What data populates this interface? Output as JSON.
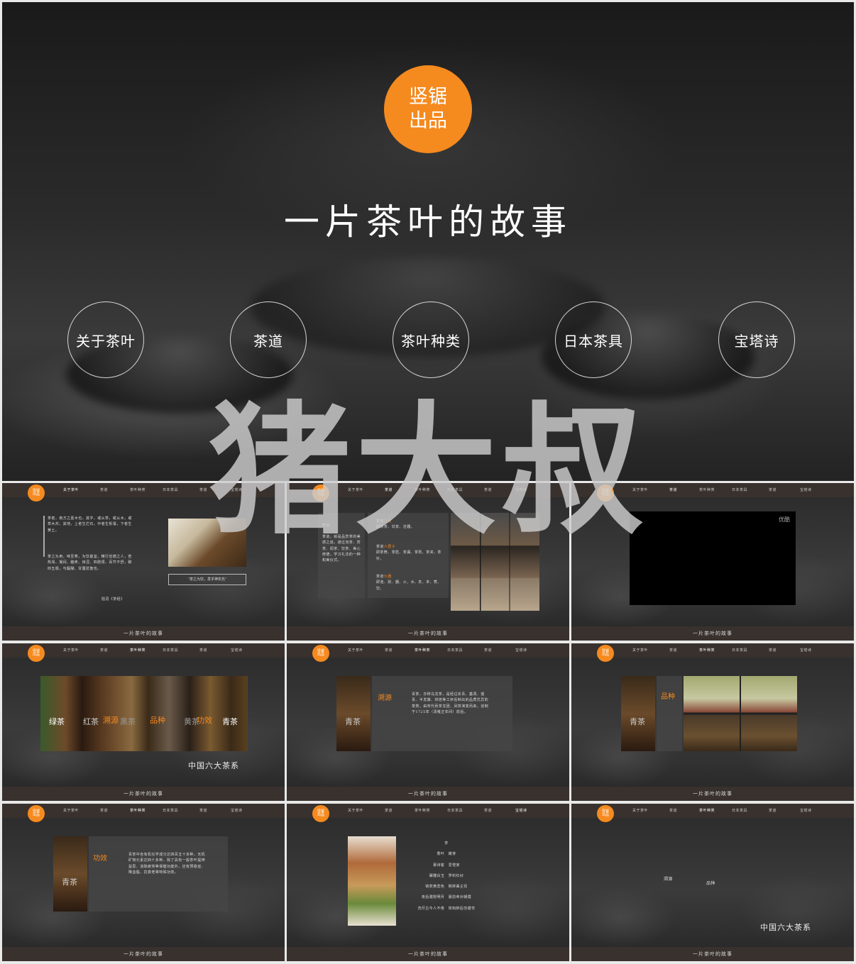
{
  "hero": {
    "logo": "竖锯\n出品",
    "title": "一片茶叶的故事",
    "nav": [
      "关于茶叶",
      "茶道",
      "茶叶种类",
      "日本茶具",
      "宝塔诗"
    ]
  },
  "watermark": "猪大叔",
  "slide_nav": {
    "logo": "竖锯\n出品",
    "items": [
      "关于茶叶",
      "茶道",
      "茶叶种类",
      "日本茶具",
      "茶道",
      "宝塔诗"
    ],
    "footer": "一片茶叶的故事"
  },
  "s1": {
    "text1": "茶者，南方之嘉木也。其字，或从草，或从木，或草木并。其地，上者生烂石，中者生栎壤，下者生黄土。",
    "text2": "茶之为用，味至寒，为饮最宜。精行俭德之人，若热渴、凝闷、脑疼、目涩、四肢烦、百节不舒，聊四五啜，与醍醐、甘露抗衡也。",
    "author": "陆羽《茶经》",
    "quote": "“茶之为饮，发乎神农氏”"
  },
  "s2": {
    "left_title": "茶道",
    "left_text": "茶道，就是品赏茶的美感之道。通过沏茶、赏茶、闻茶、饮茶、美心修德，学习礼法的一种和美仪式。",
    "r1_title": "茶道",
    "r1_hl": "三点",
    "r1_text": "即新茶、甘泉、洁器。",
    "r2_title": "茶道",
    "r2_hl": "六君子",
    "r2_text": "即茶筒、茶匙、茶漏、茶则、茶夹、茶针。",
    "r3_title": "茶道",
    "r3_hl": "九雅",
    "r3_text": "即泡、别、器、火、水、炙、末、煮、饮。"
  },
  "s3": {
    "brand": "优酷"
  },
  "s4": {
    "labels": [
      "绿茶",
      "红茶",
      "溯源",
      "黑茶",
      "品种",
      "黄茶",
      "功效",
      "青茶"
    ],
    "caption": "中国六大茶系"
  },
  "s5": {
    "side": "青茶",
    "title": "溯源",
    "text": "青茶，亦称乌龙茶，是经过杀青、萎凋、摇青、半发酵、烘焙等工序后制出的品质优异的茶类，由宋代贡茶龙团、凤饼演变而来，创制于1725年（清雍正年间）前后。"
  },
  "s6": {
    "side": "青茶",
    "title": "品种"
  },
  "s7": {
    "side": "青茶",
    "title": "功效",
    "text": "青茶中含有机化学成分达四百五十多种，无机矿物元素达四十多种，除了具有一般茶叶提神益思、消除疲劳等保健功能外，还有预癌症、降血脂、抗衰老等特殊功效。"
  },
  "s8": {
    "lines": [
      "茶",
      "香叶　嫩芽",
      "慕诗客　爱僧家",
      "碾雕白玉　罗织红纱",
      "铫煎黄蕊色　碗转曲尘花",
      "夜后邀陪明月　晨前命对朝霞",
      "洗尽古今人不倦　将知醉后岂堪夸"
    ]
  },
  "s9": {
    "a": "溯源",
    "b": "品种",
    "caption": "中国六大茶系"
  }
}
